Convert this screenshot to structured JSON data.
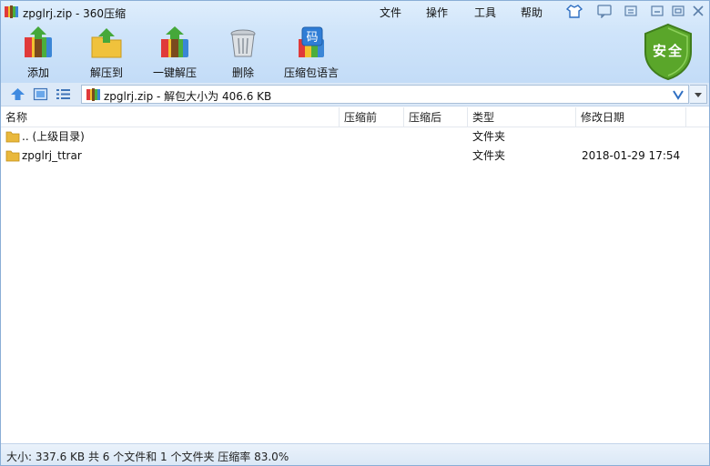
{
  "window": {
    "title": "zpglrj.zip - 360压缩"
  },
  "menu": [
    {
      "label": "文件"
    },
    {
      "label": "操作"
    },
    {
      "label": "工具"
    },
    {
      "label": "帮助"
    }
  ],
  "toolbar": [
    {
      "label": "添加",
      "icon": "add-archive-icon"
    },
    {
      "label": "解压到",
      "icon": "extract-to-icon"
    },
    {
      "label": "一键解压",
      "icon": "one-click-extract-icon"
    },
    {
      "label": "删除",
      "icon": "delete-icon"
    },
    {
      "label": "压缩包语言",
      "icon": "archive-encoding-icon",
      "icon_text": "码"
    }
  ],
  "security": {
    "label": "安全",
    "color": "#5aa62a"
  },
  "address": {
    "text": "zpglrj.zip - 解包大小为 406.6 KB"
  },
  "columns": [
    {
      "label": "名称"
    },
    {
      "label": "压缩前"
    },
    {
      "label": "压缩后"
    },
    {
      "label": "类型"
    },
    {
      "label": "修改日期"
    }
  ],
  "rows": [
    {
      "name": ".. (上级目录)",
      "before": "",
      "after": "",
      "type": "文件夹",
      "date": ""
    },
    {
      "name": "zpglrj_ttrar",
      "before": "",
      "after": "",
      "type": "文件夹",
      "date": "2018-01-29 17:54"
    }
  ],
  "status": {
    "text": "大小: 337.6 KB 共 6 个文件和 1 个文件夹 压缩率 83.0%"
  },
  "colors": {
    "accent": "#2f6fc2",
    "folder": "#e9b83c",
    "chrome": "#cfe4fa"
  }
}
